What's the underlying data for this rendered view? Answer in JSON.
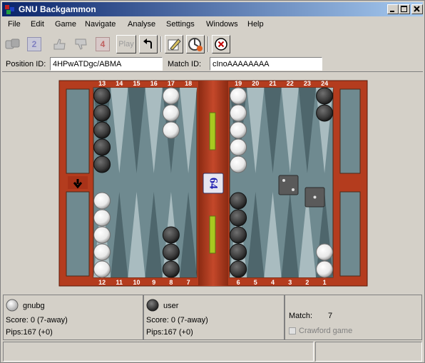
{
  "window": {
    "title": "GNU Backgammon"
  },
  "menu": [
    "File",
    "Edit",
    "Game",
    "Navigate",
    "Analyse",
    "Settings",
    "Windows",
    "Help"
  ],
  "toolbar": {
    "double_label": "2",
    "cube_label": "4",
    "play_label": "Play"
  },
  "ids": {
    "position_label": "Position ID:",
    "position_value": "4HPwATDgc/ABMA",
    "match_label": "Match ID:",
    "match_value": "cInoAAAAAAAA"
  },
  "board": {
    "top_points": [
      "13",
      "14",
      "15",
      "16",
      "17",
      "18",
      "19",
      "20",
      "21",
      "22",
      "23",
      "24"
    ],
    "bottom_points": [
      "12",
      "11",
      "10",
      "9",
      "8",
      "7",
      "6",
      "5",
      "4",
      "3",
      "2",
      "1"
    ],
    "cube_value": "64",
    "dice": [
      2,
      1
    ],
    "colors": {
      "frame": "#b43c1e",
      "felt": "#6f8a90",
      "point_light": "#a9bcc0",
      "point_dark": "#4e666c",
      "white_checker": "#ffffff",
      "black_checker": "#3a3a3a"
    }
  },
  "players": [
    {
      "name": "gnubg",
      "color": "white",
      "score": "Score:  0 (7-away)",
      "pips": "Pips:167 (+0)"
    },
    {
      "name": "user",
      "color": "black",
      "score": "Score:  0 (7-away)",
      "pips": "Pips:167 (+0)"
    }
  ],
  "match": {
    "label": "Match:",
    "length": "7",
    "crawford_label": "Crawford game"
  }
}
